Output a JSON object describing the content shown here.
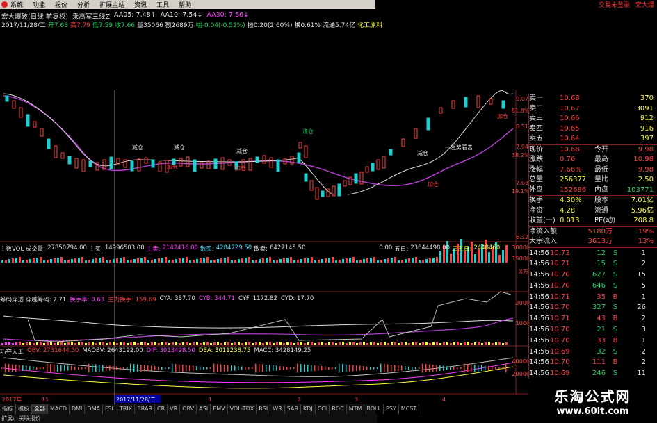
{
  "menu": {
    "items": [
      "系统",
      "功能",
      "报价",
      "分析",
      "扩展主站",
      "资讯",
      "工具",
      "帮助"
    ]
  },
  "top_right": [
    "交易未登录",
    "宏大爆"
  ],
  "header": {
    "stock_line": "宏大爆破(日线 前复权)",
    "indicator_name": "乘高军三线Z",
    "aa05": "AA05: 7.48↑",
    "aa10": "AA10: 7.54↓",
    "aa30": "AA30: 7.56↓",
    "date": "2017/11/28/二",
    "open": "开7.68",
    "high": "高7.79",
    "low": "低7.59",
    "close": "收7.66",
    "volume": "量35066",
    "amount": "额2689万",
    "change": "幅-0.04(-0.52%)",
    "amplitude": "振0.20(2.60%)",
    "turnover": "换0.61%",
    "float_cap": "流通5.74亿",
    "industry": "化工原料"
  },
  "chart_annotations": {
    "add": "加仓",
    "reduce": "减仓",
    "clear": "清仓",
    "trend": "一涨势看击"
  },
  "price_axis": [
    "9.07",
    "81.8%",
    "8.51",
    "7.94",
    "38.2%",
    "7.03",
    "19.1%",
    "6.32"
  ],
  "vol_header": {
    "title": "主数VOL 成交量:",
    "vol": "27850794.00",
    "zhumai": "主买:",
    "zhumai_v": "14996503.00",
    "zhumai2": "主卖:",
    "zhumai2_v": "2142416.00",
    "sanmai": "散买:",
    "sanmai_v": "4284729.50",
    "sanmai2": "散卖:",
    "sanmai2_v": "6427145.50",
    "extra": "",
    "zero": "0.00",
    "wuri": "五日:",
    "wuri_v": "23644498.00",
    "sanwu": "三五日:",
    "sanwu_v": "2448460"
  },
  "vol_axis": [
    "30000",
    "15000",
    "X万"
  ],
  "chip_header": {
    "title": "筹码穿透 穿越筹码: 7.71",
    "huanshou": "换手率: 0.63",
    "zhuli": "主力换手: 159.69",
    "cya": "CYA: 387.70",
    "cyb": "CYB: 344.71",
    "cyf": "CYF: 1172.82",
    "cyd": "CYD: 17.70"
  },
  "chip_axis": [
    "2000",
    "1000"
  ],
  "macd_header": {
    "title": "巧夺天工",
    "obv": "OBV: 2731644.50",
    "maobv": "MAOBV: 2643192.00",
    "dif": "DIF: 3013498.50",
    "dea": "DEA: 3011238.75",
    "macc": "MACC: 3428149.25"
  },
  "macd_axis": [
    "40000",
    "20000"
  ],
  "date_axis": [
    "2017年",
    "11",
    "2017/11/28/二",
    "1",
    "2",
    "3",
    "4"
  ],
  "quotes": {
    "asks": [
      {
        "label": "卖一",
        "price": "10.68",
        "vol": "370"
      },
      {
        "label": "卖二",
        "price": "10.67",
        "vol": "3091"
      },
      {
        "label": "卖三",
        "price": "10.66",
        "vol": "912"
      },
      {
        "label": "卖四",
        "price": "10.65",
        "vol": "916"
      },
      {
        "label": "卖五",
        "price": "10.64",
        "vol": "397"
      }
    ],
    "stats": [
      [
        "现价",
        "10.68",
        "今开",
        "9.98"
      ],
      [
        "涨跌",
        "0.76",
        "最高",
        "10.98"
      ],
      [
        "涨幅",
        "7.66%",
        "最低",
        "9.98"
      ],
      [
        "总量",
        "256377",
        "量比",
        "2.50"
      ],
      [
        "外盘",
        "152686",
        "内盘",
        "103771"
      ]
    ],
    "stats2": [
      [
        "换手",
        "4.30%",
        "股本",
        "7.01亿"
      ],
      [
        "净资",
        "4.28",
        "流通",
        "5.96亿"
      ],
      [
        "收益(一)",
        "0.013",
        "PE(动)",
        "208.8"
      ]
    ],
    "flows": [
      [
        "净流入额",
        "5180万",
        "19%"
      ],
      [
        "大宗流入",
        "3613万",
        "13%"
      ]
    ],
    "trades": [
      [
        "14:56",
        "10.72",
        "12",
        "S",
        "1"
      ],
      [
        "14:56",
        "10.71",
        "15",
        "S",
        "2"
      ],
      [
        "14:56",
        "10.70",
        "627",
        "S",
        "15"
      ],
      [
        "14:56",
        "10.70",
        "646",
        "S",
        "5"
      ],
      [
        "14:56",
        "10.71",
        "35",
        "B",
        "1"
      ],
      [
        "14:56",
        "10.70",
        "327",
        "S",
        "26"
      ],
      [
        "14:56",
        "10.71",
        "43",
        "B",
        "2"
      ],
      [
        "14:56",
        "10.70",
        "21",
        "S",
        "3"
      ],
      [
        "14:56",
        "10.70",
        "33",
        "B",
        "1"
      ],
      [
        "14:56",
        "10.69",
        "32",
        "S",
        "2"
      ],
      [
        "14:56",
        "10.70",
        "111",
        "B",
        "2"
      ],
      [
        "14:56",
        "10.69",
        "246",
        "S",
        "11"
      ]
    ]
  },
  "tabs": [
    "指标",
    "模板",
    "全部",
    "MACD",
    "DMI",
    "DMA",
    "FSL",
    "TRIX",
    "BRAR",
    "CR",
    "VR",
    "OBV",
    "ASI",
    "EMV",
    "VOL-TDX",
    "RSI",
    "WR",
    "SAR",
    "KDJ",
    "CCI",
    "ROC",
    "MTM",
    "BOLL",
    "PSY",
    "MCST"
  ],
  "bottom_bar": [
    "扩展\\",
    "关联报价"
  ],
  "brand": {
    "name": "乐淘公式网",
    "url": "www.60lt.com"
  },
  "colors": {
    "up": "#ff4040",
    "down": "#20d0d0",
    "bg": "#000000",
    "ma_magenta": "#b040d0",
    "ma_white": "#e0e0e0"
  }
}
